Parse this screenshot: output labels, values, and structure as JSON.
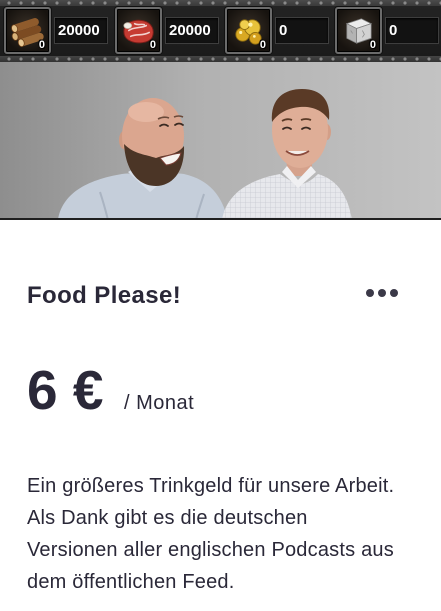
{
  "resource_bar": {
    "resources": [
      {
        "icon": "wood-logs-icon",
        "badge": "0",
        "value": "20000"
      },
      {
        "icon": "meat-icon",
        "badge": "0",
        "value": "20000"
      },
      {
        "icon": "gold-nuggets-icon",
        "badge": "0",
        "value": "0"
      },
      {
        "icon": "stone-block-icon",
        "badge": "0",
        "value": "0"
      }
    ]
  },
  "tier": {
    "title": "Food Please!",
    "more_icon": "more-horizontal-icon",
    "price": "6 €",
    "period": "/ Monat",
    "description_lines": [
      "Ein größeres Trinkgeld für unsere Arbeit.",
      "Als Dank gibt es die deutschen",
      "Versionen aller englischen Podcasts aus",
      "dem öffentlichen Feed."
    ]
  },
  "colors": {
    "text": "#2a2838",
    "dots": "#3b3948",
    "resource_bar_bg": "#232323",
    "resource_value_text": "#ffffff"
  }
}
